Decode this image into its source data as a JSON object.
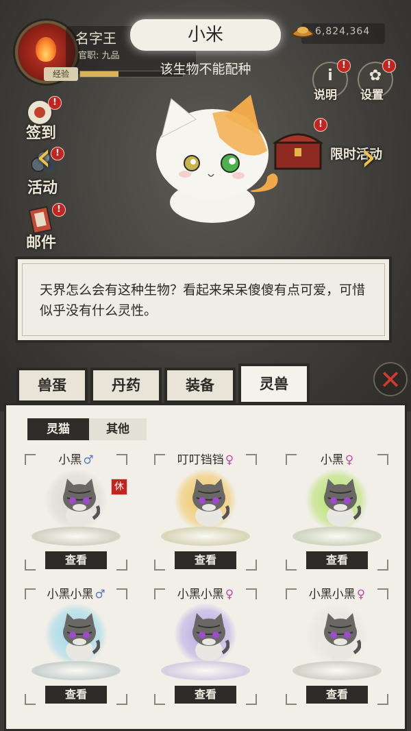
{
  "header": {
    "player_name": "名字王",
    "rank": "官职: 九品",
    "exp_label": "经验",
    "exp_progress": 0.37,
    "creature_title": "小米",
    "subtitle": "该生物不能配种",
    "gold": "6,824,364"
  },
  "buttons": {
    "help": "说明",
    "settings": "设置",
    "signin": "签到",
    "activity": "活动",
    "mail": "邮件",
    "limited_activity": "限时活动",
    "badge": "!"
  },
  "description": "天界怎么会有这种生物？看起来呆呆傻傻有点可爱，可惜似乎没有什么灵性。",
  "tabs": [
    {
      "label": "兽蛋",
      "active": false
    },
    {
      "label": "丹药",
      "active": false
    },
    {
      "label": "装备",
      "active": false
    },
    {
      "label": "灵兽",
      "active": true
    }
  ],
  "subtabs": [
    {
      "label": "灵猫",
      "active": true
    },
    {
      "label": "其他",
      "active": false
    }
  ],
  "pets": [
    {
      "name": "小黑",
      "sex": "♂",
      "gender": "male",
      "halo": "#d9d8d2",
      "resting": true,
      "lotus": "#d5d1c4"
    },
    {
      "name": "叮叮铛铛",
      "sex": "♀",
      "gender": "female",
      "halo": "#f2c45a",
      "resting": false,
      "lotus": "#d9d6b8"
    },
    {
      "name": "小黑",
      "sex": "♀",
      "gender": "female",
      "halo": "#b5e06a",
      "resting": false,
      "lotus": "#cfd6c0"
    },
    {
      "name": "小黑小黑",
      "sex": "♂",
      "gender": "male",
      "halo": "#9ad7ea",
      "resting": false,
      "lotus": "#c9d2d0"
    },
    {
      "name": "小黑小黑",
      "sex": "♀",
      "gender": "female",
      "halo": "#b5a6e6",
      "resting": false,
      "lotus": "#d3cfe2"
    },
    {
      "name": "小黑小黑",
      "sex": "♀",
      "gender": "female",
      "halo": "#e6e5e0",
      "resting": false,
      "lotus": "#d3d1c8"
    }
  ],
  "pet_labels": {
    "view": "查看",
    "rest": "休"
  }
}
